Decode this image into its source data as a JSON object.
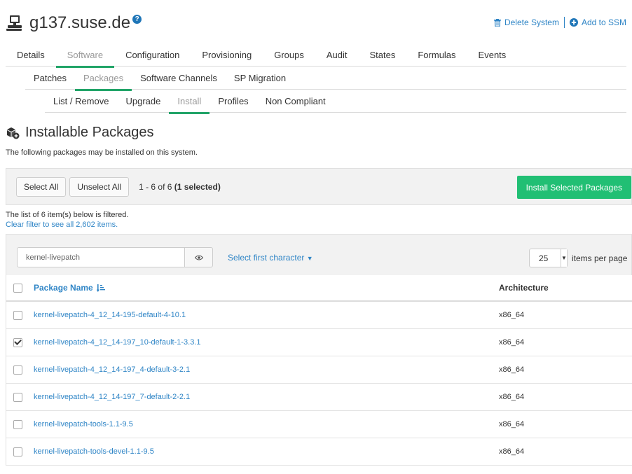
{
  "system": {
    "hostname": "g137.suse.de",
    "help_glyph": "?"
  },
  "header_actions": {
    "delete_label": "Delete System",
    "ssm_label": "Add to SSM"
  },
  "tabs_primary": [
    {
      "label": "Details",
      "active": false
    },
    {
      "label": "Software",
      "active": true
    },
    {
      "label": "Configuration",
      "active": false
    },
    {
      "label": "Provisioning",
      "active": false
    },
    {
      "label": "Groups",
      "active": false
    },
    {
      "label": "Audit",
      "active": false
    },
    {
      "label": "States",
      "active": false
    },
    {
      "label": "Formulas",
      "active": false
    },
    {
      "label": "Events",
      "active": false
    }
  ],
  "tabs_secondary": [
    {
      "label": "Patches",
      "active": false
    },
    {
      "label": "Packages",
      "active": true
    },
    {
      "label": "Software Channels",
      "active": false
    },
    {
      "label": "SP Migration",
      "active": false
    }
  ],
  "tabs_tertiary": [
    {
      "label": "List / Remove",
      "active": false
    },
    {
      "label": "Upgrade",
      "active": false
    },
    {
      "label": "Install",
      "active": true
    },
    {
      "label": "Profiles",
      "active": false
    },
    {
      "label": "Non Compliant",
      "active": false
    }
  ],
  "section": {
    "title": "Installable Packages",
    "description": "The following packages may be installed on this system."
  },
  "toolbar": {
    "select_all": "Select All",
    "unselect_all": "Unselect All",
    "range_text": "1 - 6 of 6",
    "selected_text": "(1 selected)",
    "install_button": "Install Selected Packages"
  },
  "filter_note": {
    "line1": "The list of 6 item(s) below is filtered.",
    "line2": "Clear filter to see all 2,602 items."
  },
  "filter": {
    "value": "kernel-livepatch",
    "first_char_label": "Select first character",
    "per_page_value": "25",
    "per_page_label": "items per page"
  },
  "table": {
    "headers": {
      "name": "Package Name",
      "arch": "Architecture"
    },
    "rows": [
      {
        "name": "kernel-livepatch-4_12_14-195-default-4-10.1",
        "arch": "x86_64",
        "checked": false
      },
      {
        "name": "kernel-livepatch-4_12_14-197_10-default-1-3.3.1",
        "arch": "x86_64",
        "checked": true
      },
      {
        "name": "kernel-livepatch-4_12_14-197_4-default-3-2.1",
        "arch": "x86_64",
        "checked": false
      },
      {
        "name": "kernel-livepatch-4_12_14-197_7-default-2-2.1",
        "arch": "x86_64",
        "checked": false
      },
      {
        "name": "kernel-livepatch-tools-1.1-9.5",
        "arch": "x86_64",
        "checked": false
      },
      {
        "name": "kernel-livepatch-tools-devel-1.1-9.5",
        "arch": "x86_64",
        "checked": false
      }
    ]
  },
  "colors": {
    "accent_green": "#21a468",
    "install_button": "#21bf74",
    "link_blue": "#2f85c6"
  }
}
